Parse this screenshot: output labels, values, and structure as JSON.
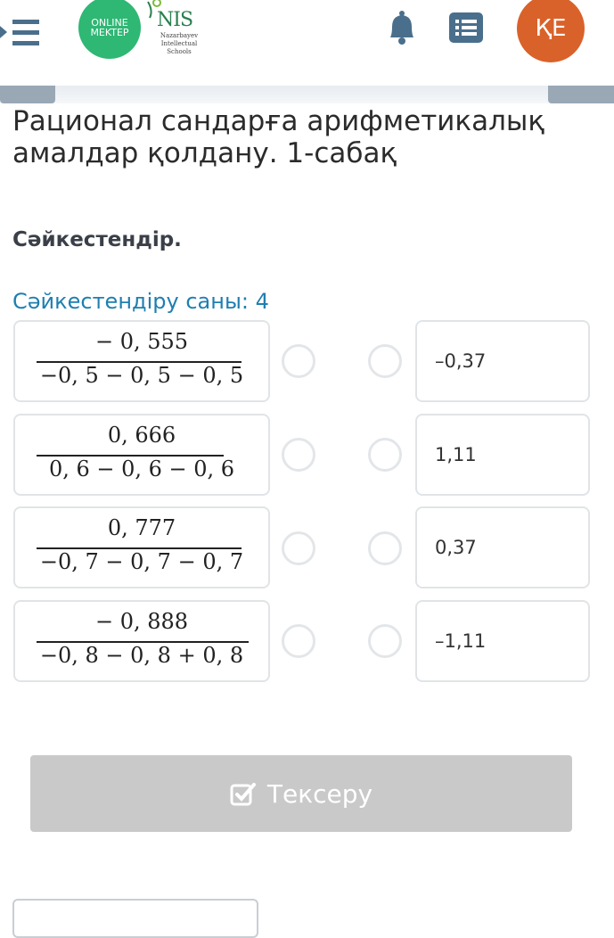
{
  "header": {
    "online_logo": {
      "line1": "ONLINE",
      "line2": "MEKTEP"
    },
    "nis_logo": {
      "title": "NIS",
      "sub1": "Nazarbayev",
      "sub2": "Intellectual",
      "sub3": "Schools"
    },
    "avatar_initials": "ҚЕ"
  },
  "lesson": {
    "title": "Рационал сандарға арифметикалық амалдар қолдану. 1-сабақ",
    "instruction": "Сәйкестендір.",
    "match_count": "Сәйкестендіру саны: 4"
  },
  "left_items": [
    {
      "numerator": "− 0, 555",
      "denominator": "−0, 5  −  0, 5  −  0, 5"
    },
    {
      "numerator": "0, 666",
      "denominator": "0, 6  −  0, 6  −  0, 6"
    },
    {
      "numerator": "0, 777",
      "denominator": "−0, 7  −  0, 7  −  0, 7"
    },
    {
      "numerator": "− 0, 888",
      "denominator": "−0, 8  −  0, 8  +  0, 8"
    }
  ],
  "right_items": [
    "–0,37",
    "1,11",
    "0,37",
    "–1,11"
  ],
  "check_button_label": "Тексеру",
  "colors": {
    "accent": "#1f7fb0",
    "avatar": "#d9622a",
    "brand_green": "#2fb774",
    "disabled_button": "#c9c9c9"
  }
}
